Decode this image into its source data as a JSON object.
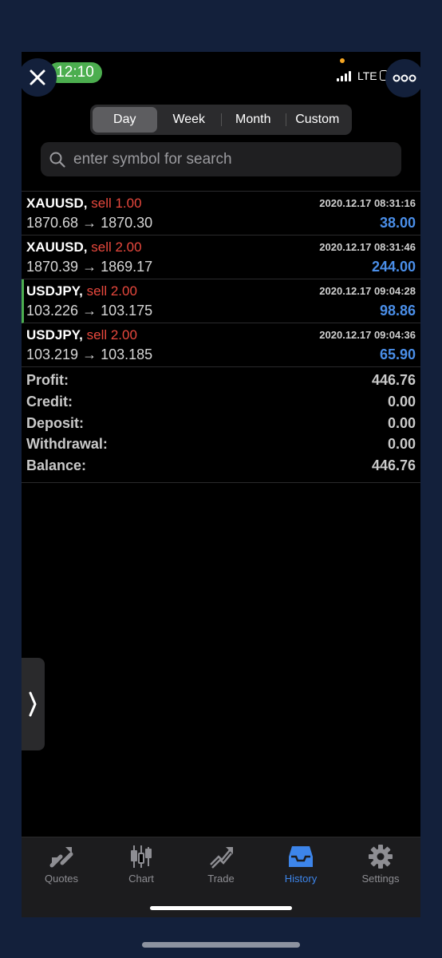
{
  "status_bar": {
    "time": "12:10",
    "network": "LTE"
  },
  "period_tabs": [
    {
      "label": "Day",
      "active": true
    },
    {
      "label": "Week",
      "active": false
    },
    {
      "label": "Month",
      "active": false
    },
    {
      "label": "Custom",
      "active": false
    }
  ],
  "search": {
    "placeholder": "enter symbol for search"
  },
  "trades": [
    {
      "symbol": "XAUUSD,",
      "side": "sell 1.00",
      "prices": "1870.68 → 1870.30",
      "datetime": "2020.12.17 08:31:16",
      "profit": "38.00"
    },
    {
      "symbol": "XAUUSD,",
      "side": "sell 2.00",
      "prices": "1870.39 → 1869.17",
      "datetime": "2020.12.17 08:31:46",
      "profit": "244.00"
    },
    {
      "symbol": "USDJPY,",
      "side": "sell 2.00",
      "prices": "103.226 → 103.175",
      "datetime": "2020.12.17 09:04:28",
      "profit": "98.86"
    },
    {
      "symbol": "USDJPY,",
      "side": "sell 2.00",
      "prices": "103.219 → 103.185",
      "datetime": "2020.12.17 09:04:36",
      "profit": "65.90"
    }
  ],
  "summary": [
    {
      "label": "Profit:",
      "value": "446.76"
    },
    {
      "label": "Credit:",
      "value": "0.00"
    },
    {
      "label": "Deposit:",
      "value": "0.00"
    },
    {
      "label": "Withdrawal:",
      "value": "0.00"
    },
    {
      "label": "Balance:",
      "value": "446.76"
    }
  ],
  "tabbar": [
    {
      "label": "Quotes",
      "icon": "quotes-icon"
    },
    {
      "label": "Chart",
      "icon": "candlestick-icon"
    },
    {
      "label": "Trade",
      "icon": "trade-icon"
    },
    {
      "label": "History",
      "icon": "inbox-icon",
      "active": true
    },
    {
      "label": "Settings",
      "icon": "gear-icon"
    }
  ],
  "colors": {
    "accent": "#3d85ea",
    "sell": "#e8483d",
    "profit": "#4a8ee8",
    "time_pill": "#4cae4f"
  }
}
